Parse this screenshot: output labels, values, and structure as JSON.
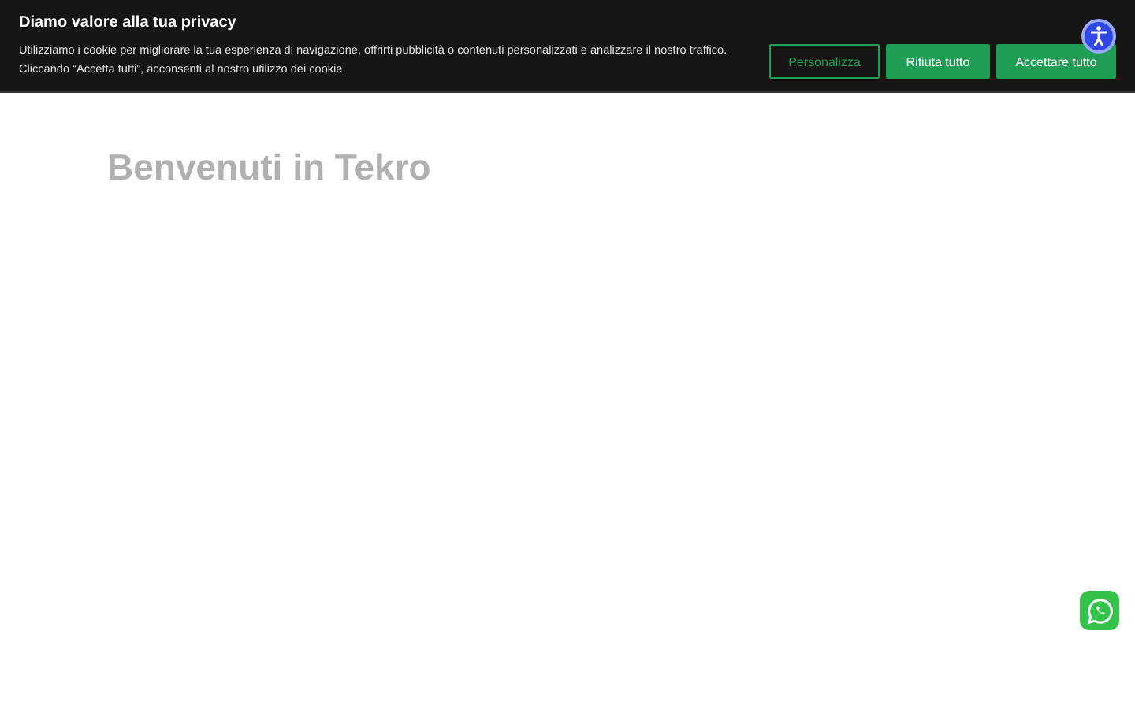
{
  "cookie_banner": {
    "title": "Diamo valore alla tua privacy",
    "text": "Utilizziamo i cookie per migliorare la tua esperienza di navigazione, offrirti pubblicità o contenuti personalizzati e analizzare il nostro traffico. Cliccando “Accetta tutti”, acconsenti al nostro utilizzo dei cookie.",
    "buttons": [
      {
        "label": "Personalizza",
        "kind": "outline"
      },
      {
        "label": "Rifiuta tutto",
        "kind": "filled"
      },
      {
        "label": "Accettare tutto",
        "kind": "filled"
      }
    ]
  },
  "page": {
    "heading": "Benvenuti in Tekro"
  }
}
